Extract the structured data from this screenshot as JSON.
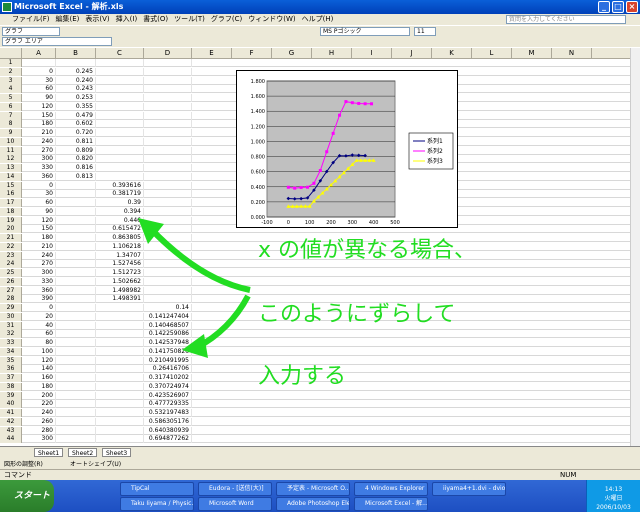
{
  "window": {
    "title": "Microsoft Excel - 解析.xls"
  },
  "menu": [
    "ファイル(F)",
    "編集(E)",
    "表示(V)",
    "挿入(I)",
    "書式(O)",
    "ツール(T)",
    "グラフ(C)",
    "ウィンドウ(W)",
    "ヘルプ(H)"
  ],
  "help_placeholder": "質問を入力してください",
  "toolbar": {
    "chart_area_combo": "グラフ エリア",
    "font_name": "MS Pゴシック",
    "font_size": "11",
    "name_box": "グラフ",
    "formula_value": ""
  },
  "columns": [
    "A",
    "B",
    "C",
    "D",
    "E",
    "F",
    "G",
    "H",
    "I",
    "J",
    "K",
    "L",
    "M",
    "N"
  ],
  "rows": [
    {
      "n": "1",
      "a": "",
      "b": "",
      "c": "",
      "d": ""
    },
    {
      "n": "2",
      "a": "0",
      "b": "0.245",
      "c": "",
      "d": ""
    },
    {
      "n": "3",
      "a": "30",
      "b": "0.240",
      "c": "",
      "d": ""
    },
    {
      "n": "4",
      "a": "60",
      "b": "0.243",
      "c": "",
      "d": ""
    },
    {
      "n": "5",
      "a": "90",
      "b": "0.253",
      "c": "",
      "d": ""
    },
    {
      "n": "6",
      "a": "120",
      "b": "0.355",
      "c": "",
      "d": ""
    },
    {
      "n": "7",
      "a": "150",
      "b": "0.479",
      "c": "",
      "d": ""
    },
    {
      "n": "8",
      "a": "180",
      "b": "0.602",
      "c": "",
      "d": ""
    },
    {
      "n": "9",
      "a": "210",
      "b": "0.720",
      "c": "",
      "d": ""
    },
    {
      "n": "10",
      "a": "240",
      "b": "0.811",
      "c": "",
      "d": ""
    },
    {
      "n": "11",
      "a": "270",
      "b": "0.809",
      "c": "",
      "d": ""
    },
    {
      "n": "12",
      "a": "300",
      "b": "0.820",
      "c": "",
      "d": ""
    },
    {
      "n": "13",
      "a": "330",
      "b": "0.816",
      "c": "",
      "d": ""
    },
    {
      "n": "14",
      "a": "360",
      "b": "0.813",
      "c": "",
      "d": ""
    },
    {
      "n": "15",
      "a": "0",
      "b": "",
      "c": "0.393616",
      "d": ""
    },
    {
      "n": "16",
      "a": "30",
      "b": "",
      "c": "0.381719",
      "d": ""
    },
    {
      "n": "17",
      "a": "60",
      "b": "",
      "c": "0.39",
      "d": ""
    },
    {
      "n": "18",
      "a": "90",
      "b": "",
      "c": "0.394",
      "d": ""
    },
    {
      "n": "19",
      "a": "120",
      "b": "",
      "c": "0.446",
      "d": ""
    },
    {
      "n": "20",
      "a": "150",
      "b": "",
      "c": "0.615472",
      "d": ""
    },
    {
      "n": "21",
      "a": "180",
      "b": "",
      "c": "0.863805",
      "d": ""
    },
    {
      "n": "22",
      "a": "210",
      "b": "",
      "c": "1.106218",
      "d": ""
    },
    {
      "n": "23",
      "a": "240",
      "b": "",
      "c": "1.34707",
      "d": ""
    },
    {
      "n": "24",
      "a": "270",
      "b": "",
      "c": "1.527456",
      "d": ""
    },
    {
      "n": "25",
      "a": "300",
      "b": "",
      "c": "1.512723",
      "d": ""
    },
    {
      "n": "26",
      "a": "330",
      "b": "",
      "c": "1.502662",
      "d": ""
    },
    {
      "n": "27",
      "a": "360",
      "b": "",
      "c": "1.498982",
      "d": ""
    },
    {
      "n": "28",
      "a": "390",
      "b": "",
      "c": "1.498391",
      "d": ""
    },
    {
      "n": "29",
      "a": "0",
      "b": "",
      "c": "",
      "d": "0.14"
    },
    {
      "n": "30",
      "a": "20",
      "b": "",
      "c": "",
      "d": "0.141247404"
    },
    {
      "n": "31",
      "a": "40",
      "b": "",
      "c": "",
      "d": "0.140468507"
    },
    {
      "n": "32",
      "a": "60",
      "b": "",
      "c": "",
      "d": "0.142259086"
    },
    {
      "n": "33",
      "a": "80",
      "b": "",
      "c": "",
      "d": "0.142537948"
    },
    {
      "n": "34",
      "a": "100",
      "b": "",
      "c": "",
      "d": "0.141750826"
    },
    {
      "n": "35",
      "a": "120",
      "b": "",
      "c": "",
      "d": "0.210491995"
    },
    {
      "n": "36",
      "a": "140",
      "b": "",
      "c": "",
      "d": "0.26416706"
    },
    {
      "n": "37",
      "a": "160",
      "b": "",
      "c": "",
      "d": "0.317410202"
    },
    {
      "n": "38",
      "a": "180",
      "b": "",
      "c": "",
      "d": "0.370724974"
    },
    {
      "n": "39",
      "a": "200",
      "b": "",
      "c": "",
      "d": "0.423526907"
    },
    {
      "n": "40",
      "a": "220",
      "b": "",
      "c": "",
      "d": "0.477729335"
    },
    {
      "n": "41",
      "a": "240",
      "b": "",
      "c": "",
      "d": "0.532197483"
    },
    {
      "n": "42",
      "a": "260",
      "b": "",
      "c": "",
      "d": "0.586305176"
    },
    {
      "n": "43",
      "a": "280",
      "b": "",
      "c": "",
      "d": "0.640380939"
    },
    {
      "n": "44",
      "a": "300",
      "b": "",
      "c": "",
      "d": "0.694877262"
    }
  ],
  "sheet_tabs": [
    "Sheet1",
    "Sheet2",
    "Sheet3"
  ],
  "draw_toolbar": {
    "draw_label": "図形の調整(R)",
    "autoshape_label": "オートシェイプ(U)"
  },
  "status": {
    "left": "コマンド",
    "right": "NUM"
  },
  "taskbar": {
    "start_label": "スタート",
    "tasks_top": [
      "TipCal",
      "Eudora - [送信(大)]",
      "予定表 - Microsoft O...",
      "4 Windows Explorer",
      "iiyama4+1.dvi - dvio..."
    ],
    "tasks_bottom": [
      "Taku Iiyama / Physic...",
      "Microsoft Word",
      "Adobe Photoshop Ele...",
      "Microsoft Excel - 解..."
    ],
    "clock_time": "14:13",
    "clock_day": "火曜日",
    "clock_date": "2006/10/03"
  },
  "annotation": {
    "line1": "x の値が異なる場合、",
    "line2": "このようにずらして",
    "line3": "入力する"
  },
  "colors": {
    "annotation": "#22dd22",
    "series1": "#000080",
    "series2": "#ff00ff",
    "series3": "#ffff00",
    "plot_bg": "#c0c0c0"
  },
  "chart_data": {
    "type": "line",
    "title": "",
    "xlabel": "",
    "ylabel": "",
    "xlim": [
      -100,
      500
    ],
    "ylim": [
      0,
      1.8
    ],
    "x_ticks": [
      "-100",
      "0",
      "100",
      "200",
      "300",
      "400",
      "500"
    ],
    "y_ticks": [
      "0.000",
      "0.200",
      "0.400",
      "0.600",
      "0.800",
      "1.000",
      "1.200",
      "1.400",
      "1.600",
      "1.800"
    ],
    "legend_position": "right",
    "grid": true,
    "series": [
      {
        "name": "系列1",
        "color": "#000080",
        "x": [
          0,
          30,
          60,
          90,
          120,
          150,
          180,
          210,
          240,
          270,
          300,
          330,
          360
        ],
        "y": [
          0.245,
          0.24,
          0.243,
          0.253,
          0.355,
          0.479,
          0.602,
          0.72,
          0.811,
          0.809,
          0.82,
          0.816,
          0.813
        ]
      },
      {
        "name": "系列2",
        "color": "#ff00ff",
        "x": [
          0,
          30,
          60,
          90,
          120,
          150,
          180,
          210,
          240,
          270,
          300,
          330,
          360,
          390
        ],
        "y": [
          0.393616,
          0.381719,
          0.39,
          0.394,
          0.446,
          0.615472,
          0.863805,
          1.106218,
          1.34707,
          1.527456,
          1.512723,
          1.502662,
          1.498982,
          1.498391
        ]
      },
      {
        "name": "系列3",
        "color": "#ffff00",
        "x": [
          0,
          20,
          40,
          60,
          80,
          100,
          120,
          140,
          160,
          180,
          200,
          220,
          240,
          260,
          280,
          300,
          320,
          340,
          360,
          380,
          400
        ],
        "y": [
          0.14,
          0.141247404,
          0.140468507,
          0.142259086,
          0.142537948,
          0.141750826,
          0.210491995,
          0.26416706,
          0.317410202,
          0.370724974,
          0.423526907,
          0.477729335,
          0.532197483,
          0.586305176,
          0.640380939,
          0.694877262,
          0.75,
          0.75,
          0.75,
          0.75,
          0.75
        ]
      }
    ]
  }
}
